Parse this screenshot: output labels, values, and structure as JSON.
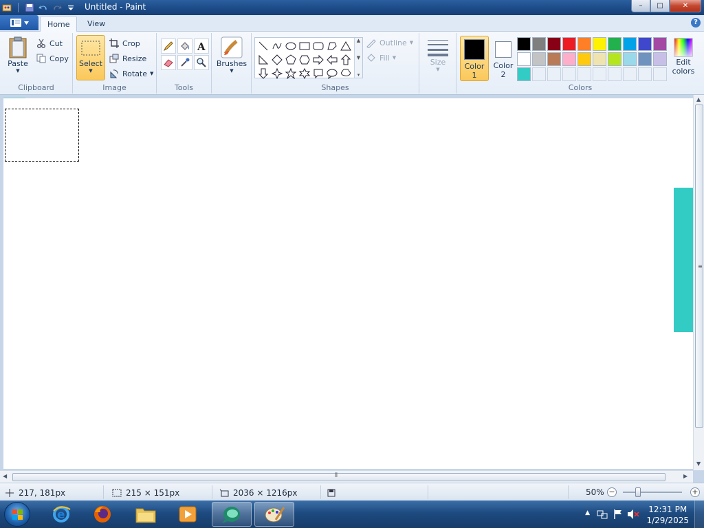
{
  "window": {
    "title": "Untitled - Paint",
    "minimize": "–",
    "maximize": "□",
    "close": "✕"
  },
  "tabs": [
    {
      "label": "Home",
      "active": true
    },
    {
      "label": "View",
      "active": false
    }
  ],
  "help": "?",
  "ribbon": {
    "clipboard": {
      "label": "Clipboard",
      "paste": "Paste",
      "cut": "Cut",
      "copy": "Copy"
    },
    "image": {
      "label": "Image",
      "select": "Select",
      "crop": "Crop",
      "resize": "Resize",
      "rotate": "Rotate"
    },
    "tools": {
      "label": "Tools"
    },
    "brushes": {
      "label": "Brushes"
    },
    "shapes": {
      "label": "Shapes",
      "outline": "Outline",
      "fill": "Fill"
    },
    "size": {
      "label": "Size"
    },
    "colors": {
      "label": "Colors",
      "color1": "Color\n1",
      "color1_a": "Color",
      "color1_b": "1",
      "color2_a": "Color",
      "color2_b": "2",
      "color1_value": "#000000",
      "color2_value": "#ffffff",
      "edit_a": "Edit",
      "edit_b": "colors",
      "palette_row1": [
        "#000000",
        "#7f7f7f",
        "#880015",
        "#ed1c24",
        "#ff7f27",
        "#fff200",
        "#22b14c",
        "#00a2e8",
        "#3f48cc",
        "#a349a4"
      ],
      "palette_row2": [
        "#ffffff",
        "#c3c3c3",
        "#b97a57",
        "#ffaec9",
        "#ffc90e",
        "#efe4b0",
        "#b5e61d",
        "#99d9ea",
        "#7092be",
        "#c8bfe7"
      ],
      "palette_row3": [
        "#33ccc4",
        "",
        "",
        "",
        "",
        "",
        "",
        "",
        "",
        ""
      ]
    }
  },
  "canvas": {
    "shape_color": "#33ccc4"
  },
  "status": {
    "cursor": "217, 181px",
    "selection": "215 × 151px",
    "image_size": "2036 × 1216px",
    "zoom": "50%"
  },
  "taskbar": {
    "time": "12:31 PM",
    "date": "1/29/2025"
  }
}
